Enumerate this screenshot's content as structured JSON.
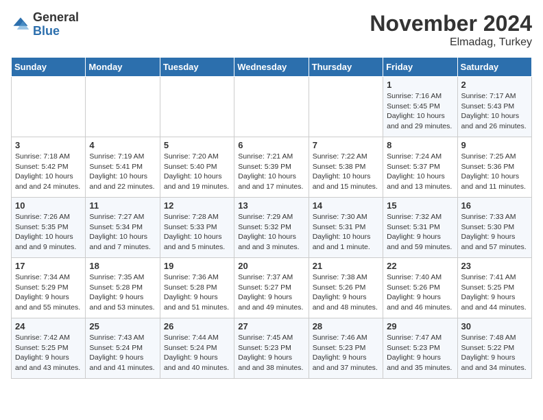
{
  "header": {
    "logo": {
      "general": "General",
      "blue": "Blue"
    },
    "title": "November 2024",
    "location": "Elmadag, Turkey"
  },
  "days_of_week": [
    "Sunday",
    "Monday",
    "Tuesday",
    "Wednesday",
    "Thursday",
    "Friday",
    "Saturday"
  ],
  "weeks": [
    [
      {
        "day": "",
        "info": ""
      },
      {
        "day": "",
        "info": ""
      },
      {
        "day": "",
        "info": ""
      },
      {
        "day": "",
        "info": ""
      },
      {
        "day": "",
        "info": ""
      },
      {
        "day": "1",
        "info": "Sunrise: 7:16 AM\nSunset: 5:45 PM\nDaylight: 10 hours and 29 minutes."
      },
      {
        "day": "2",
        "info": "Sunrise: 7:17 AM\nSunset: 5:43 PM\nDaylight: 10 hours and 26 minutes."
      }
    ],
    [
      {
        "day": "3",
        "info": "Sunrise: 7:18 AM\nSunset: 5:42 PM\nDaylight: 10 hours and 24 minutes."
      },
      {
        "day": "4",
        "info": "Sunrise: 7:19 AM\nSunset: 5:41 PM\nDaylight: 10 hours and 22 minutes."
      },
      {
        "day": "5",
        "info": "Sunrise: 7:20 AM\nSunset: 5:40 PM\nDaylight: 10 hours and 19 minutes."
      },
      {
        "day": "6",
        "info": "Sunrise: 7:21 AM\nSunset: 5:39 PM\nDaylight: 10 hours and 17 minutes."
      },
      {
        "day": "7",
        "info": "Sunrise: 7:22 AM\nSunset: 5:38 PM\nDaylight: 10 hours and 15 minutes."
      },
      {
        "day": "8",
        "info": "Sunrise: 7:24 AM\nSunset: 5:37 PM\nDaylight: 10 hours and 13 minutes."
      },
      {
        "day": "9",
        "info": "Sunrise: 7:25 AM\nSunset: 5:36 PM\nDaylight: 10 hours and 11 minutes."
      }
    ],
    [
      {
        "day": "10",
        "info": "Sunrise: 7:26 AM\nSunset: 5:35 PM\nDaylight: 10 hours and 9 minutes."
      },
      {
        "day": "11",
        "info": "Sunrise: 7:27 AM\nSunset: 5:34 PM\nDaylight: 10 hours and 7 minutes."
      },
      {
        "day": "12",
        "info": "Sunrise: 7:28 AM\nSunset: 5:33 PM\nDaylight: 10 hours and 5 minutes."
      },
      {
        "day": "13",
        "info": "Sunrise: 7:29 AM\nSunset: 5:32 PM\nDaylight: 10 hours and 3 minutes."
      },
      {
        "day": "14",
        "info": "Sunrise: 7:30 AM\nSunset: 5:31 PM\nDaylight: 10 hours and 1 minute."
      },
      {
        "day": "15",
        "info": "Sunrise: 7:32 AM\nSunset: 5:31 PM\nDaylight: 9 hours and 59 minutes."
      },
      {
        "day": "16",
        "info": "Sunrise: 7:33 AM\nSunset: 5:30 PM\nDaylight: 9 hours and 57 minutes."
      }
    ],
    [
      {
        "day": "17",
        "info": "Sunrise: 7:34 AM\nSunset: 5:29 PM\nDaylight: 9 hours and 55 minutes."
      },
      {
        "day": "18",
        "info": "Sunrise: 7:35 AM\nSunset: 5:28 PM\nDaylight: 9 hours and 53 minutes."
      },
      {
        "day": "19",
        "info": "Sunrise: 7:36 AM\nSunset: 5:28 PM\nDaylight: 9 hours and 51 minutes."
      },
      {
        "day": "20",
        "info": "Sunrise: 7:37 AM\nSunset: 5:27 PM\nDaylight: 9 hours and 49 minutes."
      },
      {
        "day": "21",
        "info": "Sunrise: 7:38 AM\nSunset: 5:26 PM\nDaylight: 9 hours and 48 minutes."
      },
      {
        "day": "22",
        "info": "Sunrise: 7:40 AM\nSunset: 5:26 PM\nDaylight: 9 hours and 46 minutes."
      },
      {
        "day": "23",
        "info": "Sunrise: 7:41 AM\nSunset: 5:25 PM\nDaylight: 9 hours and 44 minutes."
      }
    ],
    [
      {
        "day": "24",
        "info": "Sunrise: 7:42 AM\nSunset: 5:25 PM\nDaylight: 9 hours and 43 minutes."
      },
      {
        "day": "25",
        "info": "Sunrise: 7:43 AM\nSunset: 5:24 PM\nDaylight: 9 hours and 41 minutes."
      },
      {
        "day": "26",
        "info": "Sunrise: 7:44 AM\nSunset: 5:24 PM\nDaylight: 9 hours and 40 minutes."
      },
      {
        "day": "27",
        "info": "Sunrise: 7:45 AM\nSunset: 5:23 PM\nDaylight: 9 hours and 38 minutes."
      },
      {
        "day": "28",
        "info": "Sunrise: 7:46 AM\nSunset: 5:23 PM\nDaylight: 9 hours and 37 minutes."
      },
      {
        "day": "29",
        "info": "Sunrise: 7:47 AM\nSunset: 5:23 PM\nDaylight: 9 hours and 35 minutes."
      },
      {
        "day": "30",
        "info": "Sunrise: 7:48 AM\nSunset: 5:22 PM\nDaylight: 9 hours and 34 minutes."
      }
    ]
  ]
}
